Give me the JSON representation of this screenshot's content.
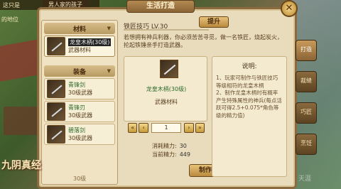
{
  "hud": {
    "player_title": "男人家的孩子",
    "left_text": "这只是",
    "left_sub": "的地位"
  },
  "window": {
    "title": "生活打造",
    "close_label": "✕"
  },
  "left_panel": {
    "sections": [
      {
        "label": "材料",
        "items": [
          {
            "name": "龙皇木柄(30级)",
            "level": "武器材料",
            "selected": true
          }
        ]
      },
      {
        "label": "装备",
        "items": [
          {
            "name": "青锋剑",
            "level": "30级武器",
            "selected": false
          },
          {
            "name": "青锋刃",
            "level": "30级武器",
            "selected": false
          },
          {
            "name": "碧落剑",
            "level": "30级武器",
            "selected": false
          }
        ]
      }
    ],
    "more_label": "30级"
  },
  "skill": {
    "label": "铁匠技巧 LV.30",
    "upgrade_label": "提升",
    "description": "若想拥有神兵利器，你必须苦苦寻觅，做一名铁匠，烧起炭火，抡起铁锤亲手打造武器。"
  },
  "selected_item": {
    "title": "龙皇木柄(30级)",
    "type": "武器材料"
  },
  "quantity": {
    "value": "1",
    "first_label": "«",
    "prev_label": "‹",
    "next_label": "›",
    "last_label": "»"
  },
  "stats": {
    "cost_label": "消耗精力:",
    "cost_value": "30",
    "current_label": "当前精力:",
    "current_value": "449"
  },
  "craft_label": "制作",
  "notes": {
    "title": "说明:",
    "body": "1、玩家可制作与铁匠技巧等级相符的龙皇木柄\n2、制作龙皇木柄时有概率产生特殊属性的神兵(每点活跃可得2.5+0.075*角色等级的精力值)"
  },
  "side_tabs": [
    {
      "label": "打造",
      "active": true
    },
    {
      "label": "裁缝",
      "active": false
    },
    {
      "label": "巧匠",
      "active": false
    },
    {
      "label": "烹饪",
      "active": false
    }
  ],
  "logo": "九阴真经",
  "watermark": "天涯"
}
